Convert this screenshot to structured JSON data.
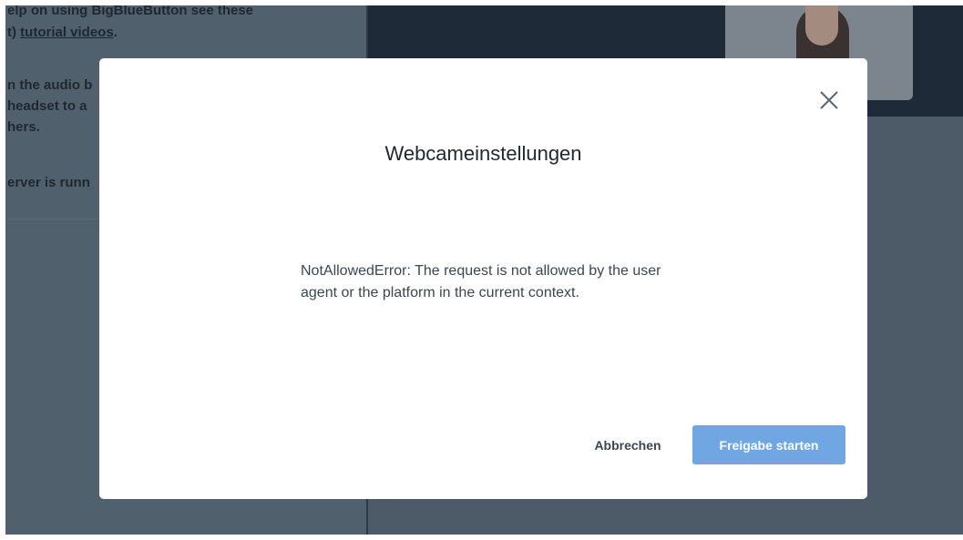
{
  "chat": {
    "lines": [
      "elp on using BigBlueButton see these",
      "t) ",
      "tutorial videos",
      ".",
      "n the audio b",
      "headset to a",
      "hers.",
      "erver is runn"
    ]
  },
  "modal": {
    "title": "Webcameinstellungen",
    "message": "NotAllowedError: The request is not allowed by the user agent or the platform in the current context.",
    "close_icon": "close-icon",
    "cancel_label": "Abbrechen",
    "start_label": "Freigabe starten"
  },
  "colors": {
    "accent": "#70a6e2",
    "dim_background": "#4d5a68",
    "video_strip": "#1e2a37"
  }
}
